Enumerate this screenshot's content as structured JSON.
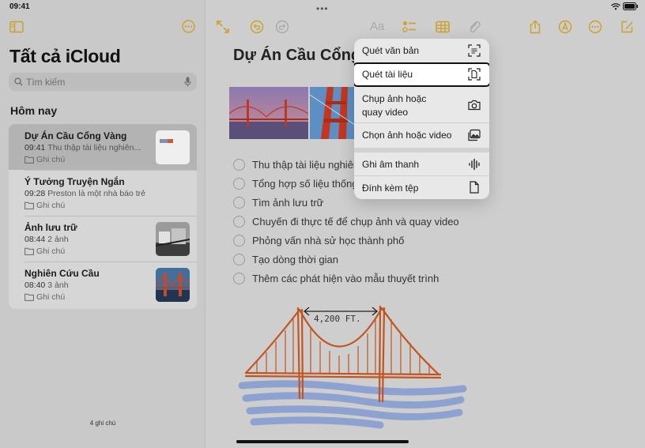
{
  "status": {
    "time": "09:41"
  },
  "sidebar": {
    "title": "Tất cả iCloud",
    "search_placeholder": "Tìm kiếm",
    "section": "Hôm nay",
    "count": "4 ghi chú",
    "notes": [
      {
        "title": "Dự Án Cầu Cổng Vàng",
        "time": "09:41",
        "preview": "Thu thập tài liệu nghiên...",
        "folder": "Ghi chú"
      },
      {
        "title": "Ý Tưởng Truyện Ngắn",
        "time": "09:28",
        "preview": "Preston là một nhà báo trẻ",
        "folder": "Ghi chú"
      },
      {
        "title": "Ảnh lưu trữ",
        "time": "08:44",
        "preview": "2 ảnh",
        "folder": "Ghi chú"
      },
      {
        "title": "Nghiên Cứu Cầu",
        "time": "08:40",
        "preview": "3 ảnh",
        "folder": "Ghi chú"
      }
    ]
  },
  "toolbar": {
    "format_label": "Aa",
    "accent": "#c9a227"
  },
  "note": {
    "title": "Dự Án Cầu Cổng",
    "checklist": [
      "Thu thập tài liệu nghiên",
      "Tổng hợp số liệu thống",
      "Tìm ảnh lưu trữ",
      "Chuyến đi thực tế để chụp ảnh và quay video",
      "Phỏng vấn nhà sử học thành phố",
      "Tạo dòng thời gian",
      "Thêm các phát hiện vào mẫu thuyết trình"
    ],
    "drawing_label": "4,200 FT."
  },
  "menu": {
    "items": [
      {
        "label": "Quét văn bản",
        "icon": "scan-text-icon"
      },
      {
        "label": "Quét tài liệu",
        "icon": "scan-document-icon"
      },
      {
        "label": "Chụp ảnh hoặc quay video",
        "label_line1": "Chụp ảnh hoặc",
        "label_line2": "quay video",
        "icon": "camera-icon"
      },
      {
        "label": "Chọn ảnh hoặc video",
        "icon": "photo-library-icon"
      },
      {
        "label": "Ghi âm thanh",
        "icon": "waveform-icon"
      },
      {
        "label": "Đính kèm tệp",
        "icon": "document-icon"
      }
    ]
  }
}
